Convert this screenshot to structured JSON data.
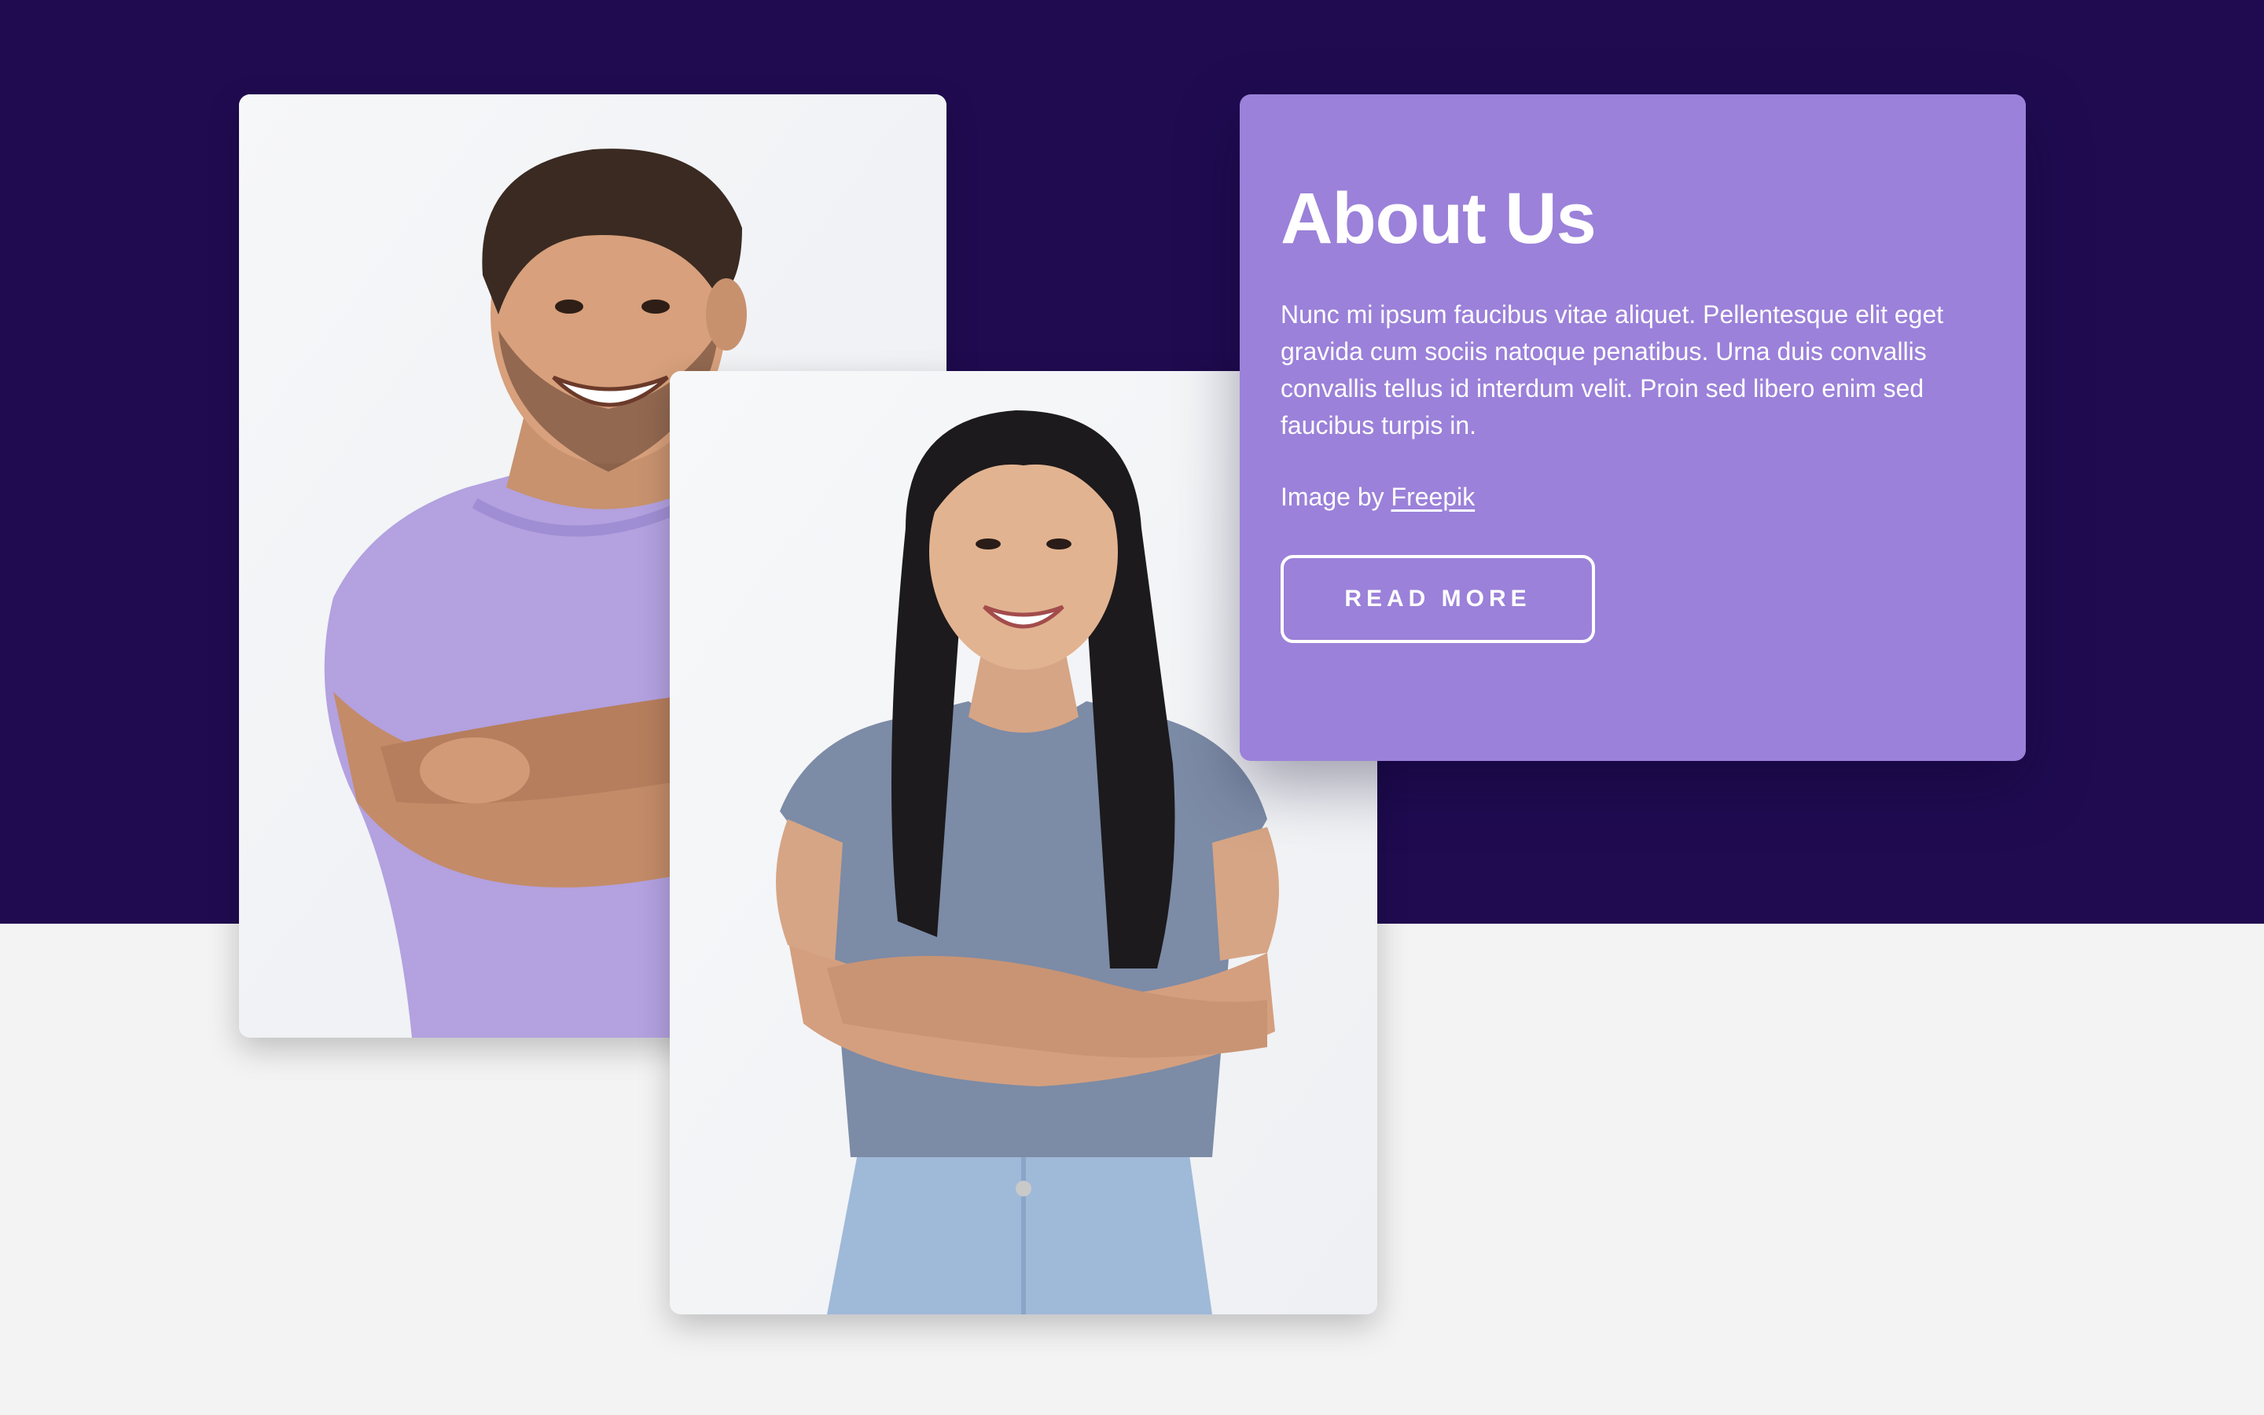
{
  "about": {
    "title": "About Us",
    "body": "Nunc mi ipsum faucibus vitae aliquet. Pellentesque elit eget gravida cum sociis natoque penatibus. Urna duis convallis convallis tellus id interdum velit. Proin sed libero enim sed faucibus turpis in.",
    "credit_prefix": "Image by",
    "credit_link": "Freepik",
    "button_label": "READ MORE"
  },
  "colors": {
    "top_band": "#200b51",
    "bottom_band": "#f3f3f3",
    "card": "#9b81d9",
    "text": "#ffffff"
  },
  "photos": [
    {
      "subject": "smiling man in lavender t-shirt with arms crossed"
    },
    {
      "subject": "smiling woman with long dark hair in grey-blue t-shirt and jeans, arms crossed"
    }
  ]
}
